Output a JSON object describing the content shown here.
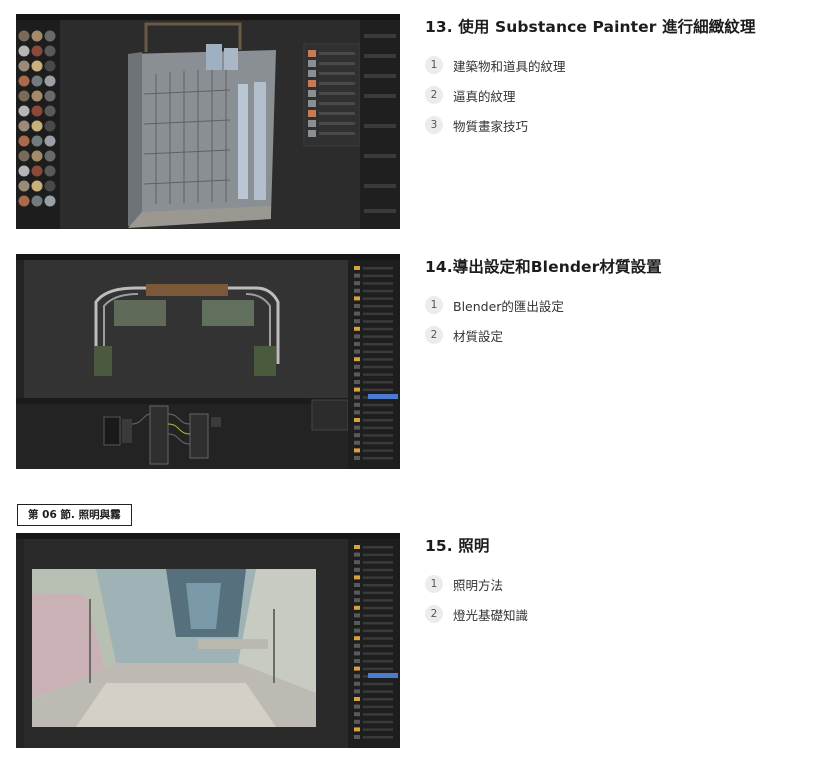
{
  "lessons": [
    {
      "title": "13. 使用 Substance Painter 進行細緻紋理",
      "items": [
        {
          "num": "1",
          "label": "建築物和道具的紋理"
        },
        {
          "num": "2",
          "label": "逼真的紋理"
        },
        {
          "num": "3",
          "label": "物質畫家技巧"
        }
      ]
    },
    {
      "title": "14.導出設定和Blender材質設置",
      "items": [
        {
          "num": "1",
          "label": "Blender的匯出設定"
        },
        {
          "num": "2",
          "label": "材質設定"
        }
      ]
    },
    {
      "title": "15. 照明",
      "items": [
        {
          "num": "1",
          "label": "照明方法"
        },
        {
          "num": "2",
          "label": "燈光基礎知識"
        }
      ]
    }
  ],
  "section": {
    "label": "第 06 節. 照明與霧"
  },
  "colors": {
    "app_bg": "#2b2b2b",
    "panel_bg": "#1e1e1e",
    "accent_blue": "#4a7bd0",
    "badge_bg": "#ececec"
  }
}
